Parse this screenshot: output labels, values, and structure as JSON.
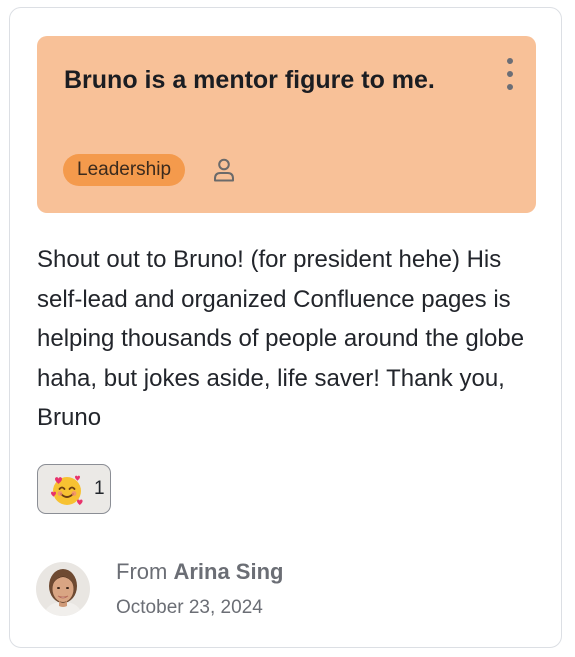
{
  "card": {
    "title": "Bruno is a mentor figure to me.",
    "tag": "Leadership",
    "message": "Shout out to Bruno! (for president hehe) His self-lead and organized Confluence pages is helping thousands of people around the globe haha, but jokes aside, life saver! Thank you, Bruno",
    "header_color": "#f8c198",
    "tag_color": "#f49a4c"
  },
  "reaction": {
    "icon": "smiling-face-with-hearts-icon",
    "count": "1"
  },
  "footer": {
    "from_prefix": "From",
    "author": "Arina Sing",
    "date": "October 23, 2024"
  },
  "icons": {
    "menu": "more-vertical-icon",
    "recipient": "person-icon"
  }
}
